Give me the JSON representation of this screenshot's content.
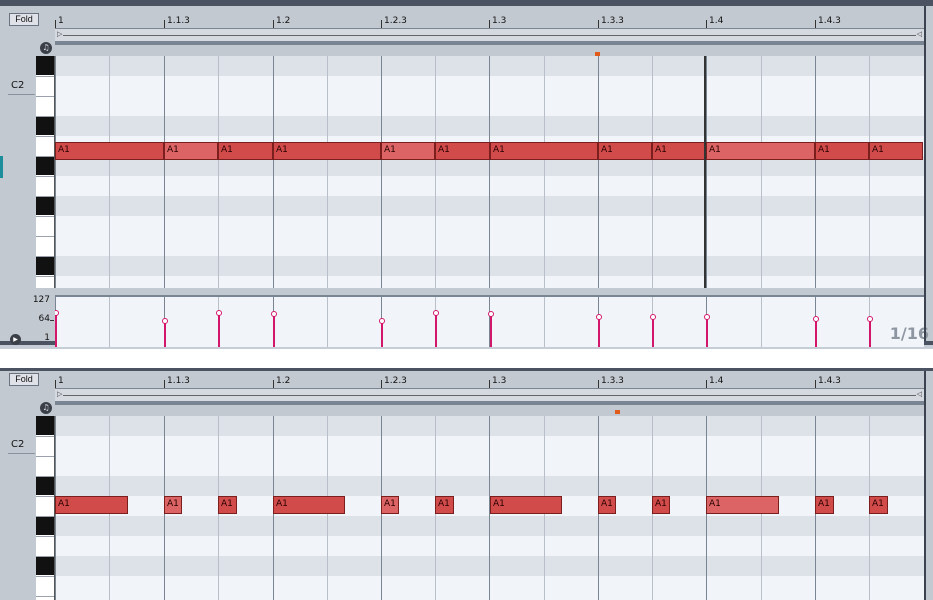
{
  "top_clip": {
    "fold_label": "Fold",
    "key_label": "C2",
    "ruler_labels": [
      "1",
      "1.1.3",
      "1.2",
      "1.2.3",
      "1.3",
      "1.3.3",
      "1.4",
      "1.4.3"
    ],
    "note_label": "A1",
    "note_count": 12,
    "velocity_scale": [
      "127",
      "64",
      "1"
    ],
    "grid_quantization": "1/16"
  },
  "bottom_clip": {
    "fold_label": "Fold",
    "key_label": "C2",
    "ruler_labels": [
      "1",
      "1.1.3",
      "1.2",
      "1.2.3",
      "1.3",
      "1.3.3",
      "1.4",
      "1.4.3"
    ],
    "note_label": "A1",
    "note_count": 12
  },
  "colors": {
    "note_fill": "#d14b4b",
    "velocity_stem": "#d4166a",
    "loop_marker": "#e05a1a",
    "grid_bg": "#f1f4f9"
  }
}
